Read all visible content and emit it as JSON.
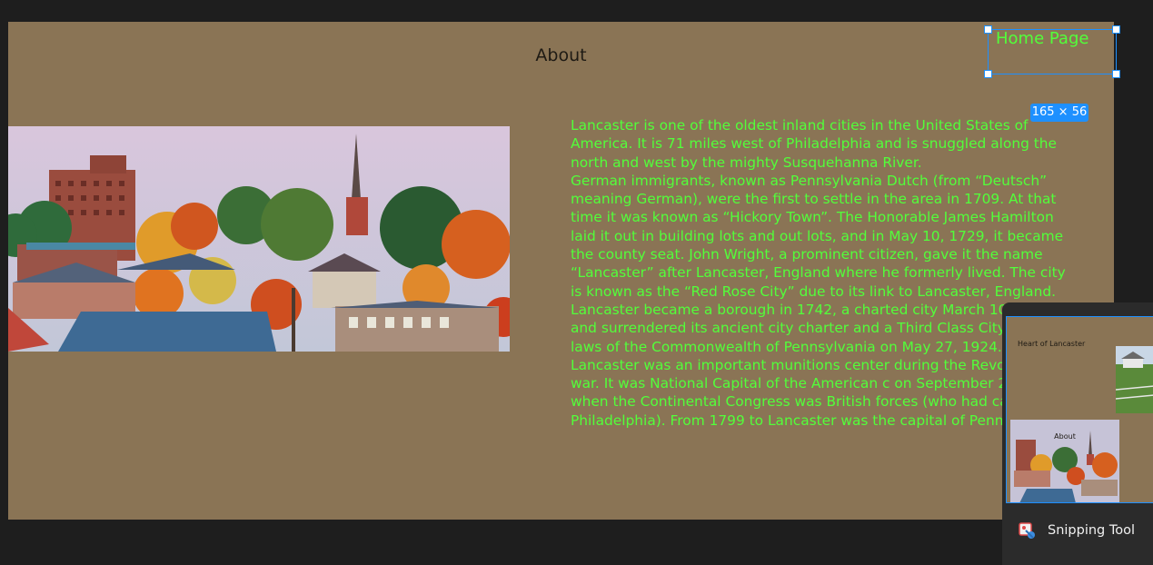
{
  "page": {
    "title": "About",
    "body_paragraphs": [
      "Lancaster is one of the oldest inland cities in the United States of America. It is 71 miles west of Philadelphia and is snuggled along the north and west by the mighty Susquehanna River.",
      "German immigrants, known as Pennsylvania Dutch (from “Deutsch” meaning German), were the first to settle in the area in 1709. At that time it was known as “Hickory Town”. The Honorable James Hamilton laid it out in building lots and out lots, and in May 10, 1729, it became the county seat. John Wright, a prominent citizen, gave it the name “Lancaster” after Lancaster, England where he formerly lived. The city is known as the “Red Rose City” due to its link to Lancaster, England. Lancaster became a borough in 1742, a charted city March 10, 1818, and surrendered its ancient city charter and a Third Class City under the laws of the Commonwealth of Pennsylvania on May 27, 1924.",
      "Lancaster was an important munitions center during the Revolutionary war. It was National Capital of the American c on September 27, 1777, when the Continental Congress was British forces (who had captured Philadelphia). From 1799 to Lancaster was the capital of Pennsylvania."
    ]
  },
  "selection": {
    "label": "Home Page",
    "dimensions": "165 × 56"
  },
  "snipping_tool": {
    "app_name": "Snipping Tool",
    "thumbnail_heading": "Heart of Lancaster",
    "thumbnail_about": "About"
  },
  "colors": {
    "background": "#1e1e1e",
    "canvas": "#8a7455",
    "body_text": "#52ff3a",
    "selection": "#1e90ff"
  }
}
